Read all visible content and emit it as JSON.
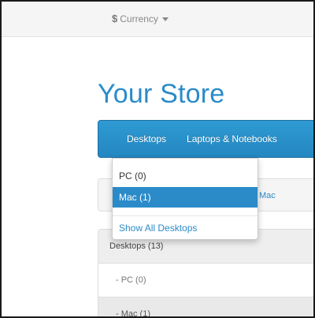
{
  "top_bar": {
    "currency_symbol": "$",
    "currency_label": "Currency"
  },
  "logo": {
    "text": "Your Store"
  },
  "nav": {
    "items": [
      {
        "label": "Desktops"
      },
      {
        "label": "Laptops & Notebooks"
      }
    ]
  },
  "dropdown": {
    "items": [
      {
        "label": "PC (0)"
      },
      {
        "label": "Mac (1)"
      }
    ],
    "show_all": "Show All Desktops"
  },
  "breadcrumb": {
    "current": "Mac"
  },
  "categories": {
    "items": [
      {
        "label": "Desktops (13)"
      },
      {
        "label": "- PC (0)"
      },
      {
        "label": "- Mac (1)"
      }
    ]
  },
  "colors": {
    "accent": "#2b8bc9",
    "nav_bg": "#2487c1",
    "active_item_bg": "#2b8bc9"
  },
  "icons": {
    "caret": "chevron-down-icon"
  }
}
